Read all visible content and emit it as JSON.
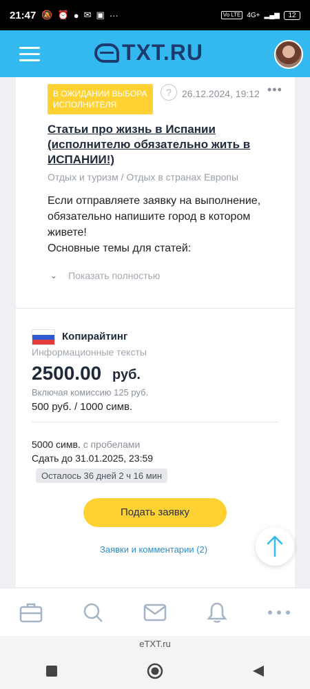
{
  "status_bar": {
    "time": "21:47",
    "network": "4G+",
    "lte_badge": "Vo LTE",
    "battery": "12"
  },
  "header": {
    "logo_text": "TXT.RU",
    "brand_color": "#33b9f0"
  },
  "order": {
    "status": "В ОЖИДАНИИ ВЫБОРА ИСПОЛНИТЕЛЯ",
    "help_symbol": "?",
    "date": "26.12.2024, 19:12",
    "title": "Статьи про жизнь в Испании (исполнителю обязательно жить в ИСПАНИИ!)",
    "category_path": "Отдых и туризм / Отдых в странах Европы",
    "description_lines": [
      "Если отправляете заявку на выполнение,",
      "обязательно напишите город в котором",
      "живете!",
      "Основные темы для статей:"
    ],
    "show_full_label": "Показать полностью"
  },
  "pricing": {
    "category": "Копирайтинг",
    "subcategory": "Информационные тексты",
    "price": "2500.00",
    "currency": "руб.",
    "commission": "Включая комиссию 125 руб.",
    "rate": "500 руб. / 1000 симв."
  },
  "details": {
    "chars_value": "5000 симв.",
    "chars_note": "с пробелами",
    "deadline": "Сдать до 31.01.2025, 23:59",
    "remaining": "Осталось 36 дней 2 ч 16 мин"
  },
  "actions": {
    "apply_label": "Подать заявку",
    "comments_label": "Заявки и комментарии (2)"
  },
  "bottom_nav": {
    "items": [
      "briefcase-icon",
      "search-icon",
      "mail-icon",
      "bell-icon",
      "more-icon"
    ]
  },
  "site_caption": "eTXT.ru",
  "colors": {
    "accent": "#33b9f0",
    "badge": "#ffd133",
    "link": "#2b8ed4"
  }
}
